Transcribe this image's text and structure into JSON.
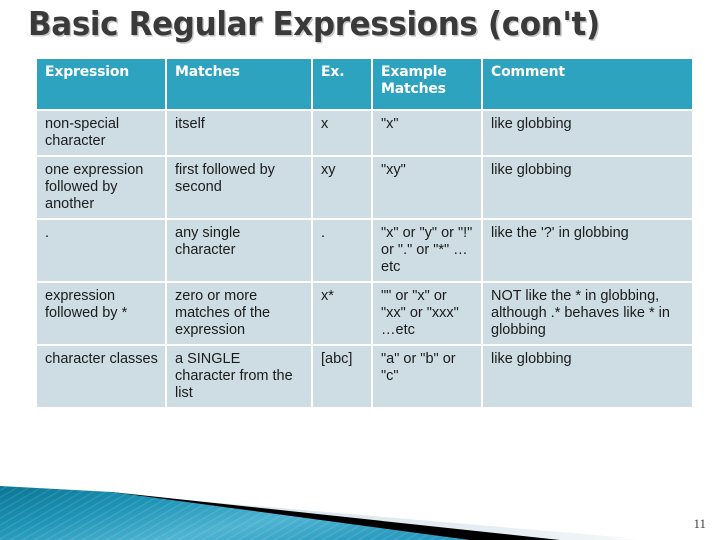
{
  "slide": {
    "title": "Basic Regular Expressions (con't)",
    "number": "11",
    "colors": {
      "header_bg": "#2ea3c0",
      "header_text": "#ffffff",
      "cell_bg": "#cedde4",
      "cell_text": "#1b1b1b",
      "title_text": "#3a3a3a",
      "background": "#ffffff",
      "ribbon_teal_dark": "#0f7fa0",
      "ribbon_teal_light": "#63bcd8",
      "ribbon_black": "#000000",
      "ribbon_pale": "#dde7ec"
    }
  },
  "table": {
    "headers": [
      "Expression",
      "Matches",
      "Ex.",
      "Example Matches",
      "Comment"
    ],
    "rows": [
      {
        "expression": "non-special character",
        "matches": "itself",
        "ex": "x",
        "example_matches": "\"x\"",
        "comment": "like globbing"
      },
      {
        "expression": "one expression followed by another",
        "matches": "first followed by second",
        "ex": "xy",
        "example_matches": "\"xy\"",
        "comment": "like globbing"
      },
      {
        "expression": ".",
        "matches": "any single character",
        "ex": ".",
        "example_matches": "\"x\" or \"y\" or \"!\" or \".\" or \"*\" …etc",
        "comment": "like the '?' in globbing"
      },
      {
        "expression": "expression followed by *",
        "matches": "zero or more matches of the expression",
        "ex": "x*",
        "example_matches": "\"\" or \"x\" or \"xx\" or \"xxx\" …etc",
        "comment": "NOT like the * in globbing, although .* behaves like * in globbing"
      },
      {
        "expression": "character classes",
        "matches": "a SINGLE character from the list",
        "ex": "[abc]",
        "example_matches": "\"a\" or \"b\" or \"c\"",
        "comment": "like globbing"
      }
    ]
  }
}
